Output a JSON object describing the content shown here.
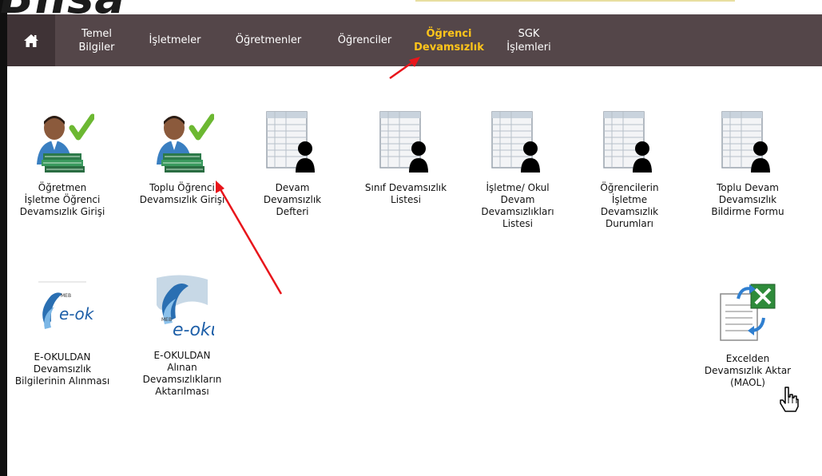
{
  "header": {
    "logo_fragment": "Bilsa"
  },
  "nav": {
    "items": [
      {
        "label_line1": "Temel",
        "label_line2": "Bilgiler"
      },
      {
        "label_line1": "İşletmeler",
        "label_line2": ""
      },
      {
        "label_line1": "Öğretmenler",
        "label_line2": ""
      },
      {
        "label_line1": "Öğrenciler",
        "label_line2": ""
      },
      {
        "label_line1": "Öğrenci",
        "label_line2": "Devamsızlık",
        "active": true
      },
      {
        "label_line1": "SGK",
        "label_line2": "İşlemleri"
      }
    ]
  },
  "tiles": {
    "t1": {
      "lines": [
        "Öğretmen",
        "İşletme Öğrenci",
        "Devamsızlık Girişi"
      ],
      "icon": "teacher-books-check-icon"
    },
    "t2": {
      "lines": [
        "Toplu Öğrenci",
        "Devamsızlık Girişi"
      ],
      "icon": "teacher-books-check-icon"
    },
    "t3": {
      "lines": [
        "Devam",
        "Devamsızlık",
        "Defteri"
      ],
      "icon": "attendance-sheet-person-icon"
    },
    "t4": {
      "lines": [
        "Sınıf Devamsızlık",
        "Listesi"
      ],
      "icon": "attendance-sheet-person-icon"
    },
    "t5": {
      "lines": [
        "İşletme/ Okul",
        "Devam",
        "Devamsızlıkları",
        "Listesi"
      ],
      "icon": "attendance-sheet-person-icon"
    },
    "t6": {
      "lines": [
        "Öğrencilerin",
        "İşletme",
        "Devamsızlık",
        "Durumları"
      ],
      "icon": "attendance-sheet-person-icon"
    },
    "t7": {
      "lines": [
        "Toplu Devam",
        "Devamsızlık",
        "Bildirme Formu"
      ],
      "icon": "attendance-sheet-person-icon"
    },
    "t8": {
      "lines": [
        "E-OKULDAN",
        "Devamsızlık",
        "Bilgilerinin Alınması"
      ],
      "icon": "e-okul-logo-icon",
      "logo_text": "e-okul"
    },
    "t9": {
      "lines": [
        "E-OKULDAN",
        "Alınan",
        "Devamsızlıkların",
        "Aktarılması"
      ],
      "icon": "e-okul-logo-icon",
      "logo_text": "e-okul"
    },
    "t10": {
      "lines": [
        "Excelden",
        "Devamsızlık Aktar",
        "(MAOL)"
      ],
      "icon": "excel-import-icon"
    }
  },
  "colors": {
    "navbar": "#544649",
    "home": "#3f3336",
    "active_nav": "#ffc51a",
    "annotation_arrow": "#e8151b"
  }
}
